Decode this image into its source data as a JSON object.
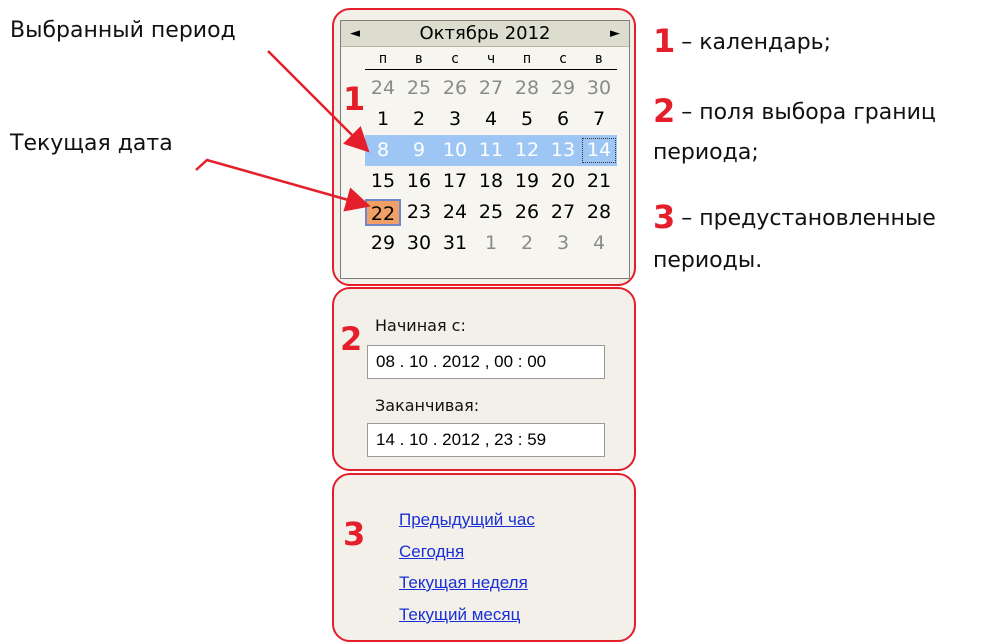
{
  "callouts": {
    "selected_period": "Выбранный период",
    "current_date": "Текущая дата"
  },
  "numbers": {
    "one": "1",
    "two": "2",
    "three": "3"
  },
  "calendar": {
    "prev_icon": "◄",
    "next_icon": "►",
    "title": "Октябрь 2012",
    "weekdays": [
      "п",
      "в",
      "с",
      "ч",
      "п",
      "с",
      "в"
    ],
    "weeks": [
      [
        "24",
        "25",
        "26",
        "27",
        "28",
        "29",
        "30"
      ],
      [
        "1",
        "2",
        "3",
        "4",
        "5",
        "6",
        "7"
      ],
      [
        "8",
        "9",
        "10",
        "11",
        "12",
        "13",
        "14"
      ],
      [
        "15",
        "16",
        "17",
        "18",
        "19",
        "20",
        "21"
      ],
      [
        "22",
        "23",
        "24",
        "25",
        "26",
        "27",
        "28"
      ],
      [
        "29",
        "30",
        "31",
        "1",
        "2",
        "3",
        "4"
      ]
    ],
    "selection_color": "#9ec6f5",
    "today_color": "#f0a064"
  },
  "dates": {
    "start_label": "Начиная с:",
    "start_value": "08 . 10 . 2012 , 00 : 00",
    "end_label": "Заканчивая:",
    "end_value": "14 . 10 . 2012 , 23 : 59"
  },
  "presets": {
    "items": [
      "Предыдущий час",
      "Сегодня",
      "Текущая неделя",
      "Текущий месяц"
    ]
  },
  "legend": {
    "items": [
      {
        "num": "1",
        "text": "– календарь;"
      },
      {
        "num": "2",
        "text": "– поля выбора границ периода;"
      },
      {
        "num": "3",
        "text": "– предустановленные периоды."
      }
    ],
    "line2_a": "– поля выбора границ",
    "line2_b": "периода;",
    "line3_a": "– предустановленные",
    "line3_b": "периоды."
  },
  "accent_color": "#e41e2a",
  "link_color": "#1a2fd6"
}
